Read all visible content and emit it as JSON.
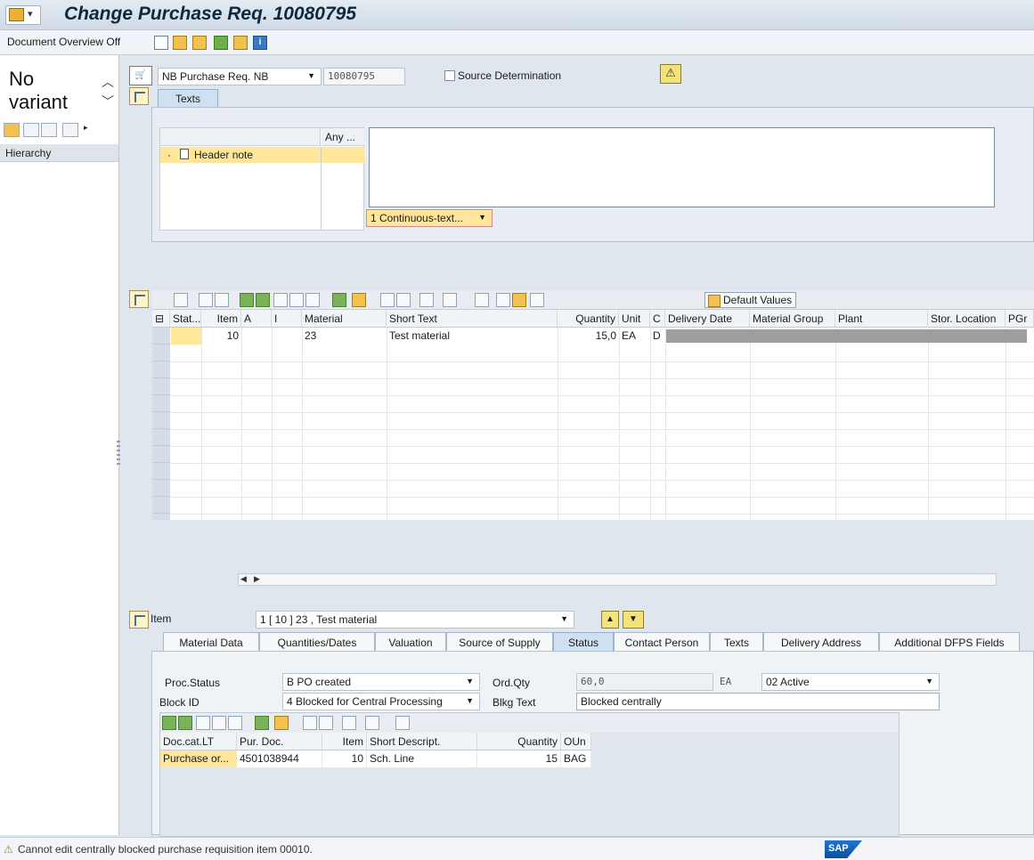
{
  "window": {
    "title": "Change Purchase Req. 10080795"
  },
  "toolbar": {
    "document_overview": "Document Overview Off"
  },
  "left_panel": {
    "variant": "No variant",
    "hierarchy": "Hierarchy"
  },
  "header": {
    "doc_type": "NB Purchase Req. NB",
    "doc_number": "10080795",
    "source_determination": "Source Determination",
    "texts_tab": "Texts",
    "text_tree_col2": "Any ...",
    "header_note": "Header note",
    "text_format": "1 Continuous-text..."
  },
  "items_toolbar": {
    "default_values": "Default Values"
  },
  "items_table": {
    "columns": [
      "Stat...",
      "Item",
      "A",
      "I",
      "Material",
      "Short Text",
      "Quantity",
      "Unit",
      "C",
      "Delivery Date",
      "Material Group",
      "Plant",
      "Stor. Location",
      "PGr"
    ],
    "rows": [
      {
        "stat": "",
        "item": "10",
        "a": "",
        "i": "",
        "material": "23",
        "short_text": "Test material",
        "quantity": "15,0",
        "unit": "EA",
        "c": "D"
      }
    ]
  },
  "item_detail": {
    "label": "Item",
    "selected_item": "1 [ 10 ] 23 , Test material",
    "tabs": [
      "Material Data",
      "Quantities/Dates",
      "Valuation",
      "Source of Supply",
      "Status",
      "Contact Person",
      "Texts",
      "Delivery Address",
      "Additional DFPS Fields"
    ],
    "active_tab": "Status",
    "status": {
      "proc_status_label": "Proc.Status",
      "proc_status_value": "B PO created",
      "ord_qty_label": "Ord.Qty",
      "ord_qty_value": "60,0",
      "ord_qty_unit": "EA",
      "active_value": "02 Active",
      "block_id_label": "Block ID",
      "block_id_value": "4 Blocked for Central Processing",
      "blkg_text_label": "Blkg Text",
      "blkg_text_value": "Blocked centrally"
    },
    "sub_table": {
      "columns": [
        "Doc.cat.LT",
        "Pur. Doc.",
        "Item",
        "Short Descript.",
        "Quantity",
        "OUn"
      ],
      "rows": [
        {
          "doc_cat": "Purchase or...",
          "pur_doc": "4501038944",
          "item": "10",
          "short_descript": "Sch. Line",
          "quantity": "15",
          "oun": "BAG"
        }
      ]
    }
  },
  "status_bar": {
    "message": "Cannot edit centrally blocked purchase requisition item 00010.",
    "logo": "SAP"
  }
}
